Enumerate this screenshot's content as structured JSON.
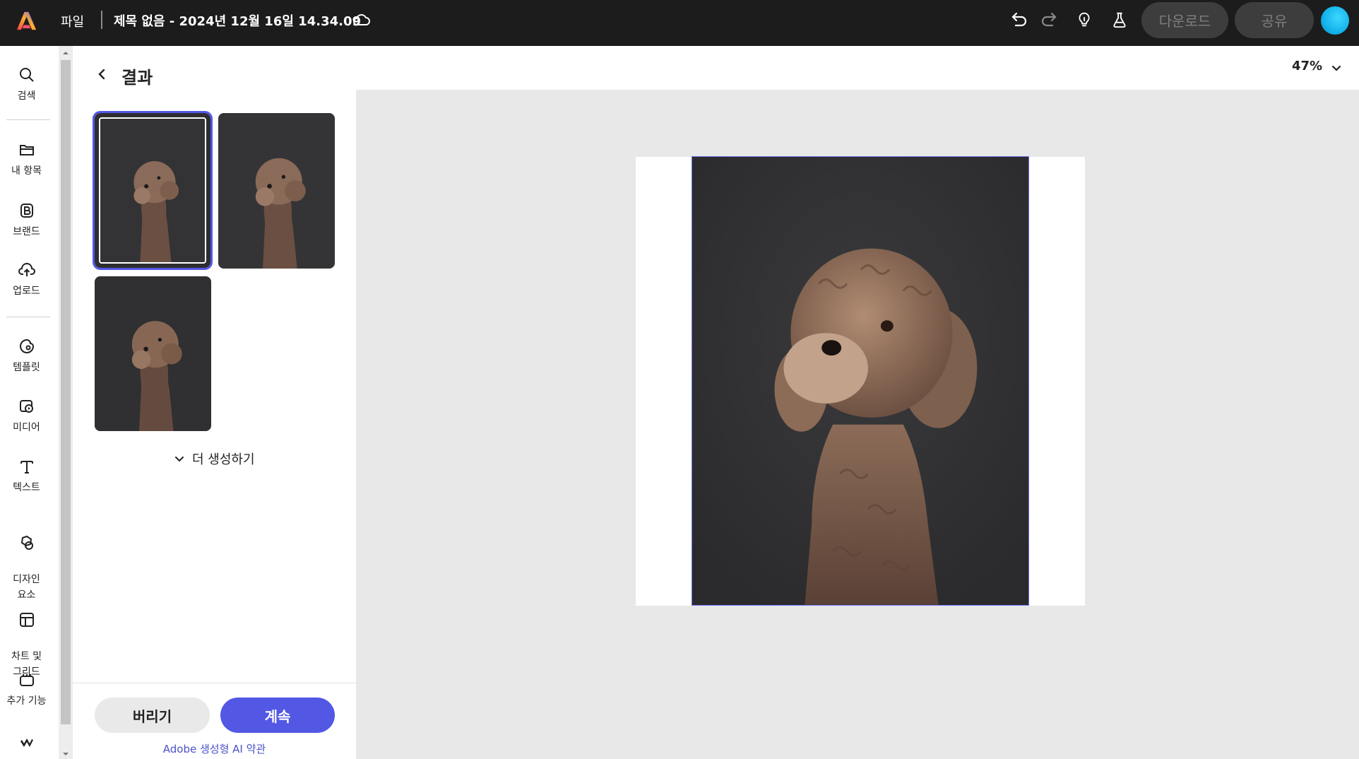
{
  "topbar": {
    "file_menu": "파일",
    "doc_title": "제목 없음 - 2024년 12월 16일 14.34.09",
    "download_label": "다운로드",
    "share_label": "공유"
  },
  "rail": {
    "items": [
      {
        "label": "검색",
        "icon": "search-icon"
      },
      {
        "label": "내 항목",
        "icon": "folder-icon"
      },
      {
        "label": "브랜드",
        "icon": "brand-icon"
      },
      {
        "label": "업로드",
        "icon": "upload-cloud-icon"
      },
      {
        "label": "템플릿",
        "icon": "template-icon"
      },
      {
        "label": "미디어",
        "icon": "media-icon"
      },
      {
        "label": "텍스트",
        "icon": "text-icon"
      },
      {
        "label": "디자인\n요소",
        "icon": "design-elements-icon"
      },
      {
        "label": "차트 및\n그리드",
        "icon": "chart-grid-icon"
      },
      {
        "label": "추가 기능",
        "icon": "addons-icon"
      }
    ]
  },
  "panel": {
    "title": "결과",
    "more_generate": "더 생성하기",
    "discard_label": "버리기",
    "continue_label": "계속",
    "terms_link": "Adobe 생성형 AI 약관"
  },
  "canvas": {
    "zoom": "47%"
  },
  "colors": {
    "accent": "#5258e4",
    "topbar_bg": "#1c1c1c",
    "canvas_bg": "#e8e8e8"
  }
}
